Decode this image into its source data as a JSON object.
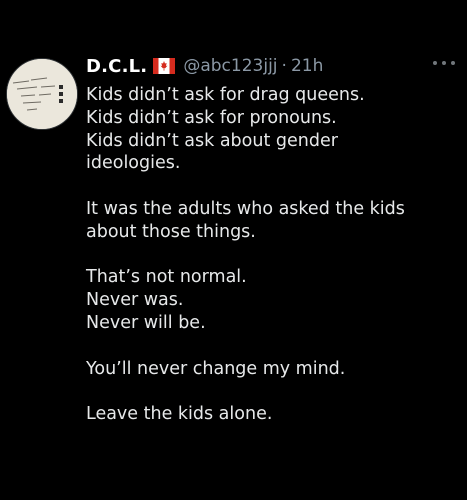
{
  "tweet": {
    "display_name": "D.C.L.",
    "flag_icon": "canada-flag-icon",
    "handle": "@abc123jjj",
    "separator": "·",
    "time": "21h",
    "more_icon": "more-options-icon",
    "avatar_icon": "typewriter-text-avatar",
    "paragraphs": [
      [
        "Kids didn’t ask for drag queens.",
        "Kids didn’t ask for pronouns.",
        "Kids didn’t ask about gender",
        "ideologies."
      ],
      [
        "It was the adults who asked the kids",
        "about those things."
      ],
      [
        "That’s not normal.",
        "Never was.",
        "Never will be."
      ],
      [
        "You’ll never change my mind."
      ],
      [
        "Leave the kids alone."
      ]
    ]
  },
  "colors": {
    "background": "#000000",
    "text": "#e7e9ea",
    "secondary": "#8b98a5",
    "flag_red": "#d52b1e"
  }
}
